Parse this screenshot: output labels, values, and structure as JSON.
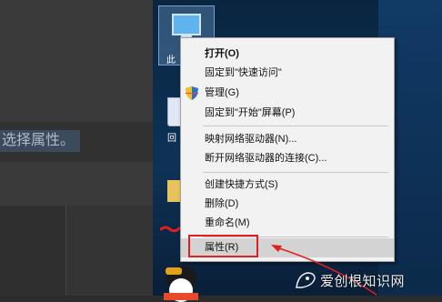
{
  "article": {
    "hint_text": "选择属性。"
  },
  "desktop": {
    "icons": [
      {
        "name": "this-pc",
        "label": "此"
      },
      {
        "name": "recycle-bin",
        "label": "回"
      }
    ]
  },
  "context_menu": {
    "items": [
      {
        "label": "打开(O)",
        "bold": true
      },
      {
        "label": "固定到\"快速访问\""
      },
      {
        "label": "管理(G)",
        "icon": "shield-icon"
      },
      {
        "label": "固定到\"开始\"屏幕(P)"
      },
      {
        "label": "映射网络驱动器(N)..."
      },
      {
        "label": "断开网络驱动器的连接(C)..."
      },
      {
        "label": "创建快捷方式(S)"
      },
      {
        "label": "删除(D)"
      },
      {
        "label": "重命名(M)"
      },
      {
        "label": "属性(R)",
        "highlighted": true
      }
    ]
  },
  "annotations": {
    "highlight_color": "#e02020"
  },
  "watermark": {
    "text": "爱创根知识网"
  }
}
